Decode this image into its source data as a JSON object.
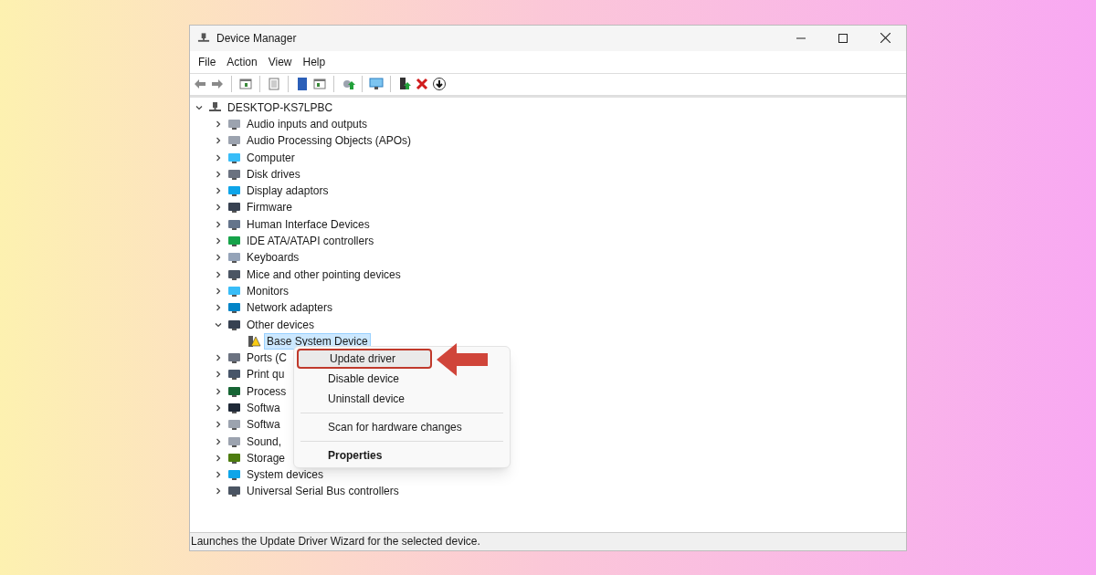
{
  "window": {
    "title": "Device Manager"
  },
  "menu_bar": [
    "File",
    "Action",
    "View",
    "Help"
  ],
  "tree": {
    "label": "DESKTOP-KS7LPBC",
    "expanded": true,
    "selected": false,
    "children": [
      {
        "label": "Audio inputs and outputs",
        "expanded": false,
        "selected": false
      },
      {
        "label": "Audio Processing Objects (APOs)",
        "expanded": false,
        "selected": false
      },
      {
        "label": "Computer",
        "expanded": false,
        "selected": false
      },
      {
        "label": "Disk drives",
        "expanded": false,
        "selected": false
      },
      {
        "label": "Display adaptors",
        "expanded": false,
        "selected": false
      },
      {
        "label": "Firmware",
        "expanded": false,
        "selected": false
      },
      {
        "label": "Human Interface Devices",
        "expanded": false,
        "selected": false
      },
      {
        "label": "IDE ATA/ATAPI controllers",
        "expanded": false,
        "selected": false
      },
      {
        "label": "Keyboards",
        "expanded": false,
        "selected": false
      },
      {
        "label": "Mice and other pointing devices",
        "expanded": false,
        "selected": false
      },
      {
        "label": "Monitors",
        "expanded": false,
        "selected": false
      },
      {
        "label": "Network adapters",
        "expanded": false,
        "selected": false
      },
      {
        "label": "Other devices",
        "expanded": true,
        "selected": false,
        "children": [
          {
            "label": "Base System Device",
            "selected": true,
            "warning": true
          }
        ]
      },
      {
        "label": "Ports (C",
        "expanded": false,
        "selected": false
      },
      {
        "label": "Print qu",
        "expanded": false,
        "selected": false
      },
      {
        "label": "Process",
        "expanded": false,
        "selected": false
      },
      {
        "label": "Softwa",
        "expanded": false,
        "selected": false
      },
      {
        "label": "Softwa",
        "expanded": false,
        "selected": false
      },
      {
        "label": "Sound,",
        "expanded": false,
        "selected": false
      },
      {
        "label": "Storage",
        "expanded": false,
        "selected": false
      },
      {
        "label": "System devices",
        "expanded": false,
        "selected": false
      },
      {
        "label": "Universal Serial Bus controllers",
        "expanded": false,
        "selected": false
      }
    ]
  },
  "context_menu": [
    {
      "label": "Update driver",
      "selected": true,
      "bold": false,
      "separator_before": false
    },
    {
      "label": "Disable device",
      "selected": false,
      "bold": false,
      "separator_before": false
    },
    {
      "label": "Uninstall device",
      "selected": false,
      "bold": false,
      "separator_before": false
    },
    {
      "label": "Scan for hardware changes",
      "selected": false,
      "bold": false,
      "separator_before": true
    },
    {
      "label": "Properties",
      "selected": false,
      "bold": true,
      "separator_before": true
    }
  ],
  "status_bar": "Launches the Update Driver Wizard for the selected device."
}
